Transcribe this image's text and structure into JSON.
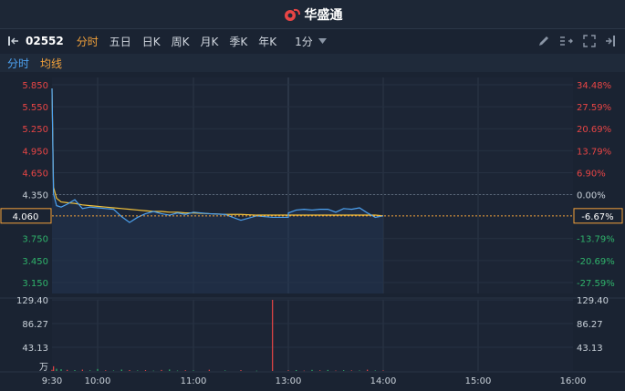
{
  "app": {
    "title": "华盛通"
  },
  "toolbar": {
    "code": "02552",
    "periods": [
      "分时",
      "五日",
      "日K",
      "周K",
      "月K",
      "季K",
      "年K"
    ],
    "active_period": "分时",
    "interval": "1分"
  },
  "subtabs": {
    "intraday": "分时",
    "avg": "均线"
  },
  "price_axis": {
    "left_labels": [
      "5.850",
      "5.550",
      "5.250",
      "4.950",
      "4.650",
      "4.350",
      "3.750",
      "3.450",
      "3.150"
    ],
    "left_values": [
      5.85,
      5.55,
      5.25,
      4.95,
      4.65,
      4.35,
      3.75,
      3.45,
      3.15
    ],
    "right_labels": [
      "34.48%",
      "27.59%",
      "20.69%",
      "13.79%",
      "6.90%",
      "0.00%",
      "-13.79%",
      "-20.69%",
      "-27.59%"
    ],
    "prev_close": 4.35,
    "current_price": "4.060",
    "current_pct": "-6.67%"
  },
  "volume_axis": {
    "labels": [
      "129.40",
      "86.27",
      "43.13"
    ],
    "unit": "万"
  },
  "time_axis": [
    "9:30",
    "10:00",
    "11:00",
    "13:00",
    "14:00",
    "15:00",
    "16:00"
  ],
  "colors": {
    "up": "#e84545",
    "down": "#2fb36b",
    "price_line": "#4da3f2",
    "avg_line": "#f3c33b",
    "accent": "#f3a23b"
  },
  "chart_data": {
    "type": "line",
    "title": "",
    "xlabel": "",
    "ylabel": "",
    "ylim": [
      3.0,
      5.95
    ],
    "x": [
      "9:30",
      "9:31",
      "9:33",
      "9:36",
      "9:40",
      "9:45",
      "9:50",
      "9:55",
      "10:00",
      "10:05",
      "10:10",
      "10:15",
      "10:20",
      "10:25",
      "10:30",
      "10:35",
      "10:40",
      "10:45",
      "10:50",
      "10:55",
      "11:00",
      "11:05",
      "11:10",
      "11:15",
      "11:20",
      "11:25",
      "11:30",
      "13:00",
      "13:05",
      "13:10",
      "13:15",
      "13:20",
      "13:25",
      "13:30",
      "13:35",
      "13:40",
      "13:45",
      "13:50",
      "13:55",
      "14:00"
    ],
    "series": [
      {
        "values": [
          5.8,
          4.36,
          4.2,
          4.18,
          4.22,
          4.28,
          4.16,
          4.18,
          4.17,
          4.16,
          4.15,
          4.05,
          3.97,
          4.04,
          4.09,
          4.12,
          4.09,
          4.07,
          4.1,
          4.08,
          4.11,
          4.09,
          4.08,
          4.0,
          4.06,
          4.04,
          4.04,
          4.1,
          4.14,
          4.15,
          4.14,
          4.15,
          4.15,
          4.11,
          4.16,
          4.15,
          4.17,
          4.1,
          4.04,
          4.06
        ]
      },
      {
        "values": [
          5.8,
          4.45,
          4.3,
          4.25,
          4.24,
          4.23,
          4.21,
          4.2,
          4.19,
          4.18,
          4.17,
          4.16,
          4.15,
          4.14,
          4.13,
          4.12,
          4.12,
          4.11,
          4.11,
          4.1,
          4.1,
          4.09,
          4.08,
          4.08,
          4.07,
          4.07,
          4.07,
          4.07,
          4.07,
          4.07,
          4.07,
          4.07,
          4.07,
          4.07,
          4.07,
          4.07,
          4.07,
          4.07,
          4.07,
          4.06
        ]
      }
    ],
    "volume": [
      2.1,
      8.5,
      4.0,
      3.2,
      2.0,
      1.5,
      2.4,
      1.1,
      3.6,
      1.2,
      0.8,
      2.5,
      1.7,
      0.9,
      1.5,
      0.6,
      1.9,
      2.7,
      0.7,
      1.3,
      1.0,
      2.2,
      0.9,
      1.6,
      0.5,
      129.4,
      0.8,
      1.2,
      1.7,
      0.6,
      2.0,
      1.1,
      1.9,
      0.7,
      1.4,
      1.0,
      0.8,
      2.3,
      0.9,
      1.0
    ],
    "volume_up": [
      true,
      true,
      false,
      false,
      true,
      false,
      true,
      false,
      false,
      true,
      false,
      false,
      true,
      false,
      true,
      false,
      true,
      false,
      false,
      true,
      false,
      true,
      false,
      true,
      false,
      true,
      false,
      true,
      false,
      true,
      false,
      true,
      false,
      true,
      false,
      true,
      false,
      true,
      false,
      true
    ]
  }
}
